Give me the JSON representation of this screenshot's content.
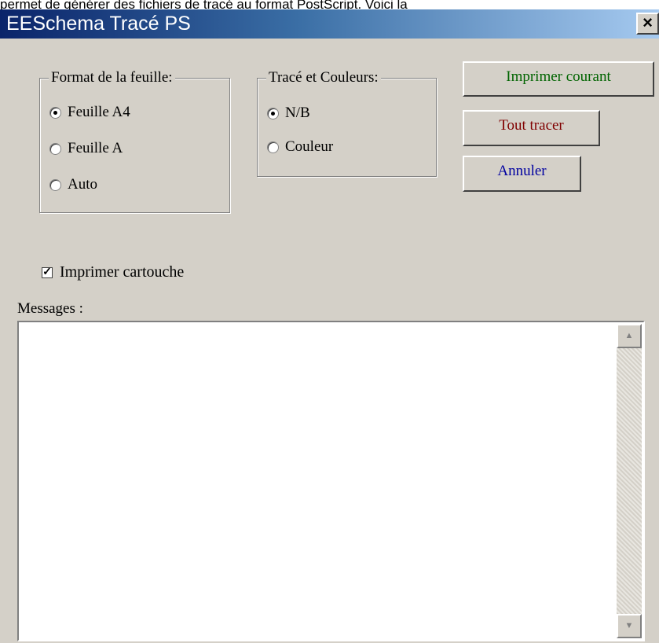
{
  "top_text": "permet de générer des fichiers de tracé au format PostScript. Voici la",
  "window": {
    "title": "EESchema Tracé PS",
    "close": "×"
  },
  "format_group": {
    "legend": "Format de la feuille:",
    "options": [
      "Feuille A4",
      "Feuille A",
      "Auto"
    ],
    "selected": "Feuille A4"
  },
  "color_group": {
    "legend": "Tracé et Couleurs:",
    "options": [
      "N/B",
      "Couleur"
    ],
    "selected": "N/B"
  },
  "buttons": {
    "print_current": {
      "label": "Imprimer courant",
      "color": "#006400"
    },
    "plot_all": {
      "label": "Tout tracer",
      "color": "#800000"
    },
    "cancel": {
      "label": "Annuler",
      "color": "#0000a0"
    }
  },
  "checkbox": {
    "label": "Imprimer cartouche",
    "checked": true,
    "mark": "✓"
  },
  "messages": {
    "label": "Messages :",
    "content": ""
  },
  "scrollbar": {
    "up": "▲",
    "down": "▼"
  }
}
